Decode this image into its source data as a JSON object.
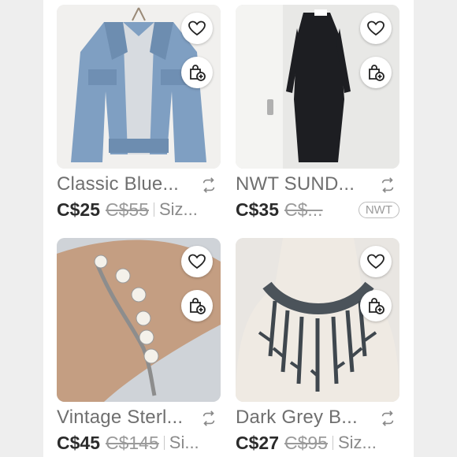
{
  "listings": [
    {
      "title": "Classic Blue...",
      "price": "C$25",
      "original_price": "C$55",
      "size": "Siz...",
      "badge": ""
    },
    {
      "title": "NWT SUND...",
      "price": "C$35",
      "original_price": "C$...",
      "size": "",
      "badge": "NWT"
    },
    {
      "title": "Vintage Sterl...",
      "price": "C$45",
      "original_price": "C$145",
      "size": "Si...",
      "badge": ""
    },
    {
      "title": "Dark Grey B...",
      "price": "C$27",
      "original_price": "C$95",
      "size": "Siz...",
      "badge": ""
    }
  ],
  "icons": {
    "like": "heart-icon",
    "bag": "shopping-bag-plus-icon",
    "share": "share-icon"
  }
}
